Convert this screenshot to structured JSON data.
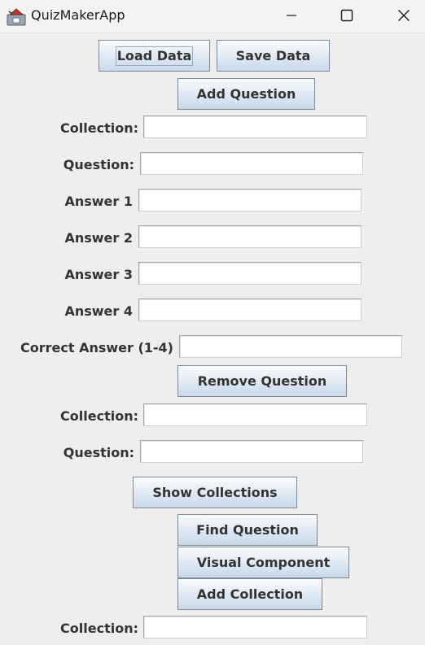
{
  "window": {
    "title": "QuizMakerApp",
    "icon": "java-app-icon",
    "controls": [
      "minimize-icon",
      "maximize-icon",
      "close-icon"
    ]
  },
  "buttons": {
    "load_data": "Load Data",
    "save_data": "Save Data",
    "add_question": "Add Question",
    "remove_question": "Remove Question",
    "show_collections": "Show Collections",
    "find_question": "Find Question",
    "visual_component": "Visual Component",
    "add_collection": "Add Collection"
  },
  "add_question_form": {
    "collection_label": "Collection:",
    "collection_value": "",
    "question_label": "Question:",
    "question_value": "",
    "answer1_label": "Answer 1",
    "answer1_value": "",
    "answer2_label": "Answer 2",
    "answer2_value": "",
    "answer3_label": "Answer 3",
    "answer3_value": "",
    "answer4_label": "Answer 4",
    "answer4_value": "",
    "correct_label": "Correct Answer (1-4)",
    "correct_value": ""
  },
  "remove_question_form": {
    "collection_label": "Collection:",
    "collection_value": "",
    "question_label": "Question:",
    "question_value": ""
  },
  "add_collection_form": {
    "collection_label": "Collection:",
    "collection_value": ""
  }
}
